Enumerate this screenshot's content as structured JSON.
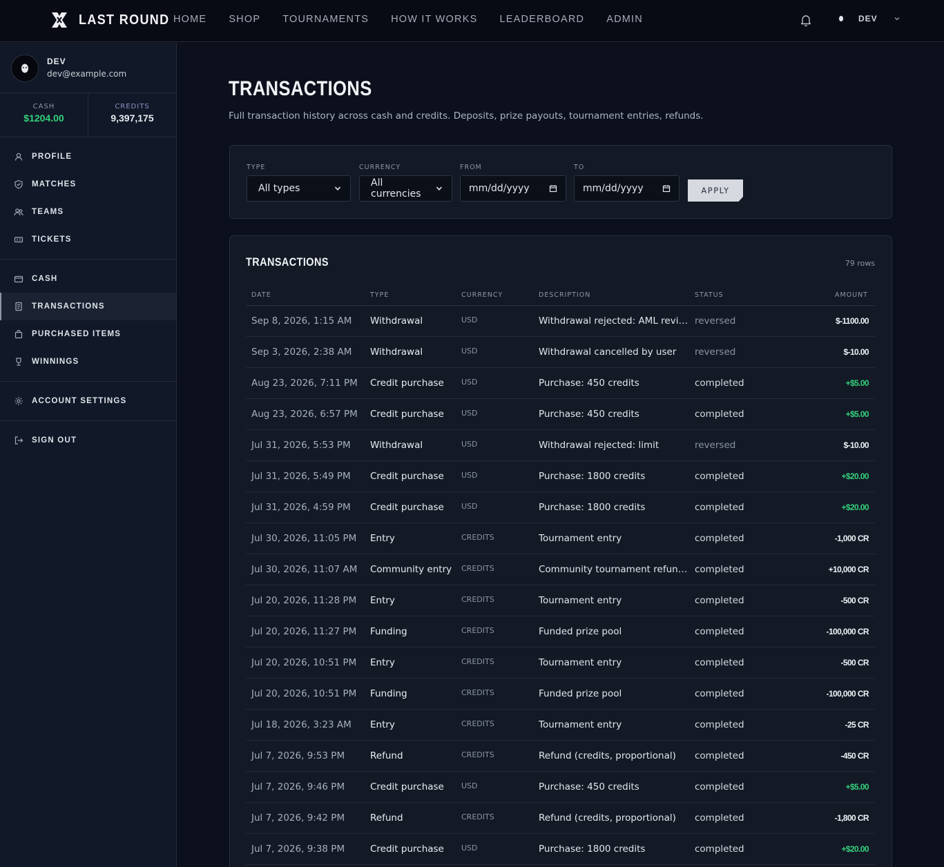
{
  "brand": {
    "name": "LAST ROUND"
  },
  "nav": [
    "HOME",
    "SHOP",
    "TOURNAMENTS",
    "HOW IT WORKS",
    "LEADERBOARD",
    "ADMIN"
  ],
  "user_menu": {
    "name": "DEV"
  },
  "sidebar": {
    "profile": {
      "name": "DEV",
      "email": "dev@example.com"
    },
    "balances": {
      "cash_label": "CASH",
      "cash_value": "$1204.00",
      "credits_label": "CREDITS",
      "credits_value": "9,397,175"
    },
    "items": [
      {
        "label": "PROFILE",
        "icon": "user-icon"
      },
      {
        "label": "MATCHES",
        "icon": "shield-icon"
      },
      {
        "label": "TEAMS",
        "icon": "users-icon"
      },
      {
        "label": "TICKETS",
        "icon": "ticket-icon"
      },
      {
        "label": "CASH",
        "icon": "wallet-icon"
      },
      {
        "label": "TRANSACTIONS",
        "icon": "receipt-icon"
      },
      {
        "label": "PURCHASED ITEMS",
        "icon": "bag-icon"
      },
      {
        "label": "WINNINGS",
        "icon": "trophy-icon"
      },
      {
        "label": "ACCOUNT SETTINGS",
        "icon": "gear-icon"
      },
      {
        "label": "SIGN OUT",
        "icon": "logout-icon"
      }
    ]
  },
  "page": {
    "title": "TRANSACTIONS",
    "subtitle": "Full transaction history across cash and credits. Deposits, prize payouts, tournament entries, refunds."
  },
  "filters": {
    "type_label": "TYPE",
    "type_value": "All types",
    "currency_label": "CURRENCY",
    "currency_value": "All currencies",
    "from_label": "FROM",
    "from_value": "mm/dd/yyyy",
    "to_label": "TO",
    "to_value": "mm/dd/yyyy",
    "apply_label": "APPLY"
  },
  "table": {
    "title": "TRANSACTIONS",
    "row_count": "79 rows",
    "columns": [
      "DATE",
      "TYPE",
      "CURRENCY",
      "DESCRIPTION",
      "STATUS",
      "AMOUNT"
    ],
    "rows": [
      {
        "date": "Sep 8, 2026, 1:15 AM",
        "type": "Withdrawal",
        "currency": "USD",
        "description": "Withdrawal rejected: AML review",
        "status": "reversed",
        "amount": "$-1100.00",
        "sign": "neg"
      },
      {
        "date": "Sep 3, 2026, 2:38 AM",
        "type": "Withdrawal",
        "currency": "USD",
        "description": "Withdrawal cancelled by user",
        "status": "reversed",
        "amount": "$-10.00",
        "sign": "neg"
      },
      {
        "date": "Aug 23, 2026, 7:11 PM",
        "type": "Credit purchase",
        "currency": "USD",
        "description": "Purchase: 450 credits",
        "status": "completed",
        "amount": "+$5.00",
        "sign": "pos"
      },
      {
        "date": "Aug 23, 2026, 6:57 PM",
        "type": "Credit purchase",
        "currency": "USD",
        "description": "Purchase: 450 credits",
        "status": "completed",
        "amount": "+$5.00",
        "sign": "pos"
      },
      {
        "date": "Jul 31, 2026, 5:53 PM",
        "type": "Withdrawal",
        "currency": "USD",
        "description": "Withdrawal rejected: limit",
        "status": "reversed",
        "amount": "$-10.00",
        "sign": "neg"
      },
      {
        "date": "Jul 31, 2026, 5:49 PM",
        "type": "Credit purchase",
        "currency": "USD",
        "description": "Purchase: 1800 credits",
        "status": "completed",
        "amount": "+$20.00",
        "sign": "pos"
      },
      {
        "date": "Jul 31, 2026, 4:59 PM",
        "type": "Credit purchase",
        "currency": "USD",
        "description": "Purchase: 1800 credits",
        "status": "completed",
        "amount": "+$20.00",
        "sign": "pos"
      },
      {
        "date": "Jul 30, 2026, 11:05 PM",
        "type": "Entry",
        "currency": "CREDITS",
        "description": "Tournament entry",
        "status": "completed",
        "amount": "-1,000 CR",
        "sign": "neg"
      },
      {
        "date": "Jul 30, 2026, 11:07 AM",
        "type": "Community entry",
        "currency": "CREDITS",
        "description": "Community tournament refund...",
        "status": "completed",
        "amount": "+10,000 CR",
        "sign": "neg"
      },
      {
        "date": "Jul 20, 2026, 11:28 PM",
        "type": "Entry",
        "currency": "CREDITS",
        "description": "Tournament entry",
        "status": "completed",
        "amount": "-500 CR",
        "sign": "neg"
      },
      {
        "date": "Jul 20, 2026, 11:27 PM",
        "type": "Funding",
        "currency": "CREDITS",
        "description": "Funded prize pool",
        "status": "completed",
        "amount": "-100,000 CR",
        "sign": "neg"
      },
      {
        "date": "Jul 20, 2026, 10:51 PM",
        "type": "Entry",
        "currency": "CREDITS",
        "description": "Tournament entry",
        "status": "completed",
        "amount": "-500 CR",
        "sign": "neg"
      },
      {
        "date": "Jul 20, 2026, 10:51 PM",
        "type": "Funding",
        "currency": "CREDITS",
        "description": "Funded prize pool",
        "status": "completed",
        "amount": "-100,000 CR",
        "sign": "neg"
      },
      {
        "date": "Jul 18, 2026, 3:23 AM",
        "type": "Entry",
        "currency": "CREDITS",
        "description": "Tournament entry",
        "status": "completed",
        "amount": "-25 CR",
        "sign": "neg"
      },
      {
        "date": "Jul 7, 2026, 9:53 PM",
        "type": "Refund",
        "currency": "CREDITS",
        "description": "Refund (credits, proportional)",
        "status": "completed",
        "amount": "-450 CR",
        "sign": "neg"
      },
      {
        "date": "Jul 7, 2026, 9:46 PM",
        "type": "Credit purchase",
        "currency": "USD",
        "description": "Purchase: 450 credits",
        "status": "completed",
        "amount": "+$5.00",
        "sign": "pos"
      },
      {
        "date": "Jul 7, 2026, 9:42 PM",
        "type": "Refund",
        "currency": "CREDITS",
        "description": "Refund (credits, proportional)",
        "status": "completed",
        "amount": "-1,800 CR",
        "sign": "neg"
      },
      {
        "date": "Jul 7, 2026, 9:38 PM",
        "type": "Credit purchase",
        "currency": "USD",
        "description": "Purchase: 1800 credits",
        "status": "completed",
        "amount": "+$20.00",
        "sign": "pos"
      }
    ]
  }
}
